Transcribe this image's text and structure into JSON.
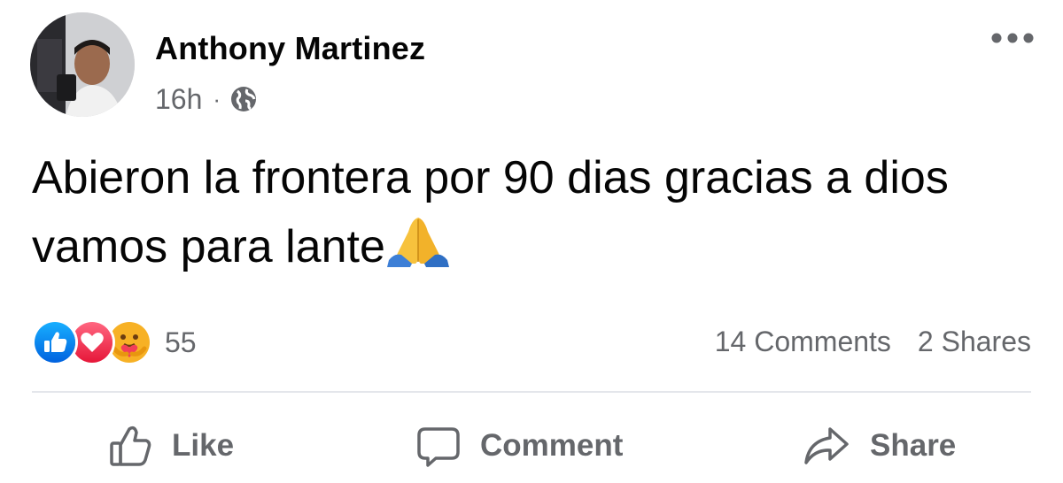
{
  "post": {
    "author_name": "Anthony Martinez",
    "timestamp": "16h",
    "separator": "·",
    "audience_icon": "globe-icon",
    "text": "Abieron la frontera por 90 dias gracias a dios vamos para lante",
    "emoji": "folded-hands"
  },
  "engagement": {
    "reaction_icons": [
      "like-reaction-icon",
      "love-reaction-icon",
      "care-reaction-icon"
    ],
    "reaction_count": "55",
    "comments_label": "14 Comments",
    "shares_label": "2 Shares"
  },
  "actions": {
    "like_label": "Like",
    "comment_label": "Comment",
    "share_label": "Share"
  },
  "colors": {
    "like_blue": "#1877f2",
    "love_red": "#f33e58",
    "care_yellow": "#f7b125",
    "secondary_text": "#65676b",
    "primary_text": "#050505",
    "divider": "#e4e6eb"
  }
}
